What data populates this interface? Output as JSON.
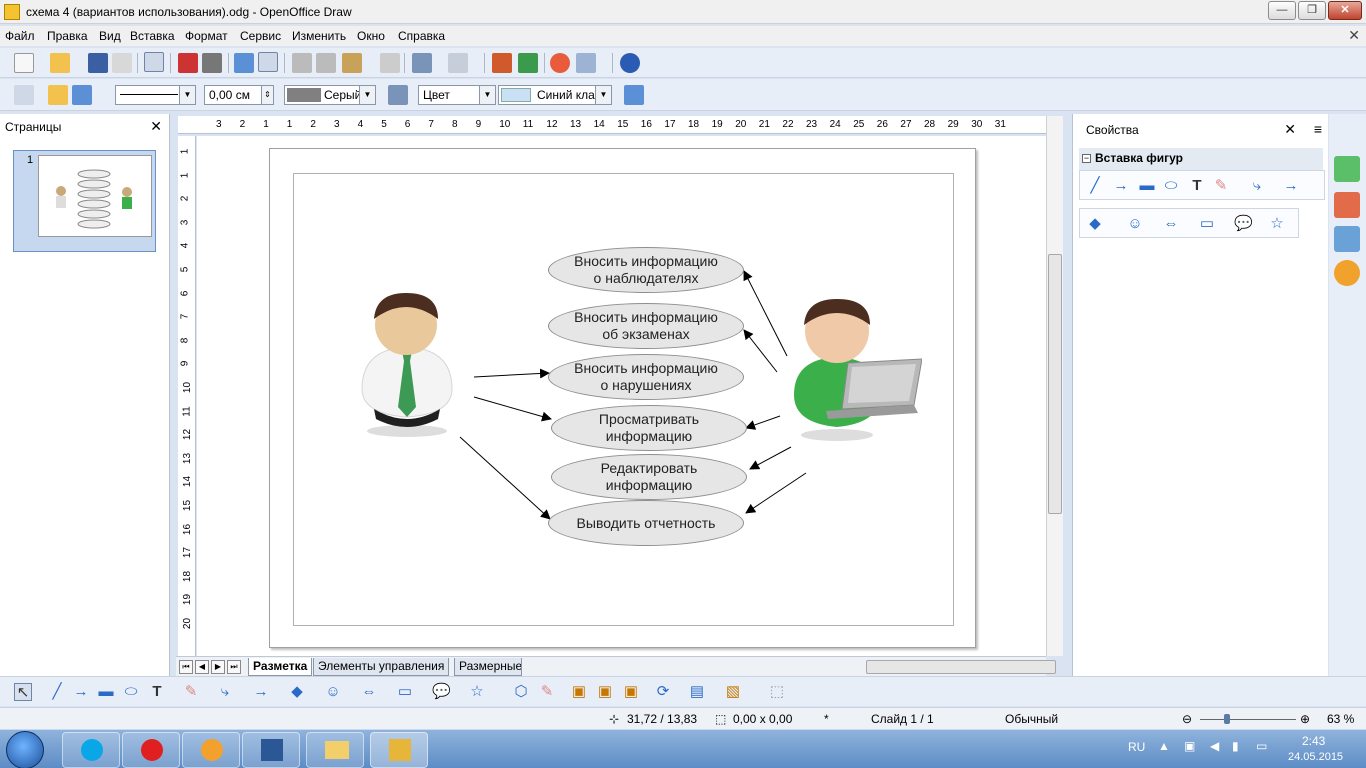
{
  "window": {
    "title": "схема 4 (вариантов использования).odg - OpenOffice Draw",
    "minimize": "—",
    "maximize": "❐",
    "close": "✕"
  },
  "menu": [
    "Файл",
    "Правка",
    "Вид",
    "Вставка",
    "Формат",
    "Сервис",
    "Изменить",
    "Окно",
    "Справка"
  ],
  "menu_close": "✕",
  "line_toolbar": {
    "line_width": "0,00 см",
    "line_color": "Серый",
    "area_style": "Цвет",
    "area_color": "Синий кла"
  },
  "pages_panel": {
    "title": "Страницы",
    "close": "✕",
    "page_number": "1"
  },
  "ruler": {
    "h_labels": [
      "3",
      "2",
      "1",
      "1",
      "2",
      "3",
      "4",
      "5",
      "6",
      "7",
      "8",
      "9",
      "10",
      "11",
      "12",
      "13",
      "14",
      "15",
      "16",
      "17",
      "18",
      "19",
      "20",
      "21",
      "22",
      "23",
      "24",
      "25",
      "26",
      "27",
      "28",
      "29",
      "30",
      "31"
    ],
    "v_labels": [
      "1",
      "1",
      "2",
      "3",
      "4",
      "5",
      "6",
      "7",
      "8",
      "9",
      "10",
      "11",
      "12",
      "13",
      "14",
      "15",
      "16",
      "17",
      "18",
      "19",
      "20"
    ]
  },
  "diagram": {
    "use_cases": [
      "Вносить информацию\nо наблюдателях",
      "Вносить информацию\nоб экзаменах",
      "Вносить информацию\nо нарушениях",
      "Просматривать\nинформацию",
      "Редактировать\nинформацию",
      "Выводить отчетность"
    ]
  },
  "tabs": [
    "Разметка",
    "Элементы управления",
    "Размерные"
  ],
  "properties": {
    "title": "Свойства",
    "close": "✕",
    "menu": "≡",
    "section": "Вставка фигур",
    "section_toggle": "−"
  },
  "status": {
    "position": "31,72 / 13,83",
    "size": "0,00 x 0,00",
    "modified": "*",
    "slide": "Слайд 1 / 1",
    "layout": "Обычный",
    "zoom": "63 %"
  },
  "tray": {
    "lang": "RU",
    "time": "2:43",
    "date": "24.05.2015"
  },
  "colors": {
    "accent": "#2a6bc7",
    "canvas_bg": "#d9e3f1"
  }
}
